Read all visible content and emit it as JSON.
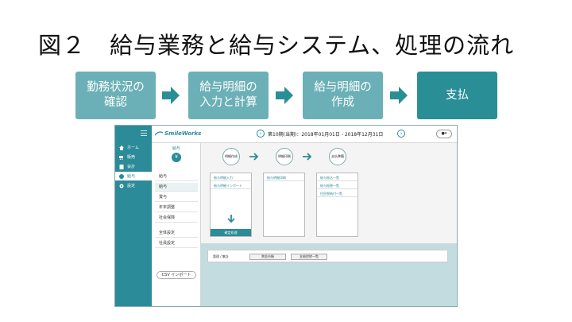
{
  "slide": {
    "title": "図２　給与業務と給与システム、処理の流れ"
  },
  "flow": {
    "steps": [
      {
        "label": "勤務状況の\n確認"
      },
      {
        "label": "給与明細の\n入力と計算"
      },
      {
        "label": "給与明細の\n作成"
      },
      {
        "label": "支払"
      }
    ],
    "colors": {
      "light": "#6bb0b6",
      "dark": "#2a8e96",
      "arrow": "#2a8e96"
    }
  },
  "app": {
    "sidebar": {
      "items": [
        {
          "label": "ホーム",
          "icon": "home-icon"
        },
        {
          "label": "販売",
          "icon": "cart-icon"
        },
        {
          "label": "会計",
          "icon": "ledger-icon"
        },
        {
          "label": "給与",
          "icon": "coin-icon",
          "active": true
        },
        {
          "label": "設定",
          "icon": "gear-icon"
        }
      ]
    },
    "header": {
      "logo": "SmileWorks",
      "period": "第10期(当期)：2018年01月01日 - 2018年12月31日",
      "user": "▾"
    },
    "subnav": {
      "heading": "給与",
      "icon": "¥",
      "items": [
        "給与",
        "給与",
        "賞与",
        "年末調整",
        "社会保険",
        "全体設定",
        "社員設定"
      ],
      "selected_index": 1,
      "csv_button": "CSV インポート"
    },
    "workflow": {
      "nodes": [
        "明細作成",
        "明細印刷",
        "支払準備"
      ],
      "columns": [
        {
          "items": [
            "給与明細入力",
            "給与明細インポート"
          ],
          "button": "確定処理"
        },
        {
          "items": [
            "給与明細印刷"
          ]
        },
        {
          "items": [
            "給与振込一覧",
            "給与振替一覧",
            "住民税納付一覧"
          ]
        }
      ]
    },
    "bottom": {
      "label": "管理 / 集計",
      "buttons": [
        "賞金台帳",
        "支給控除一覧"
      ]
    }
  }
}
